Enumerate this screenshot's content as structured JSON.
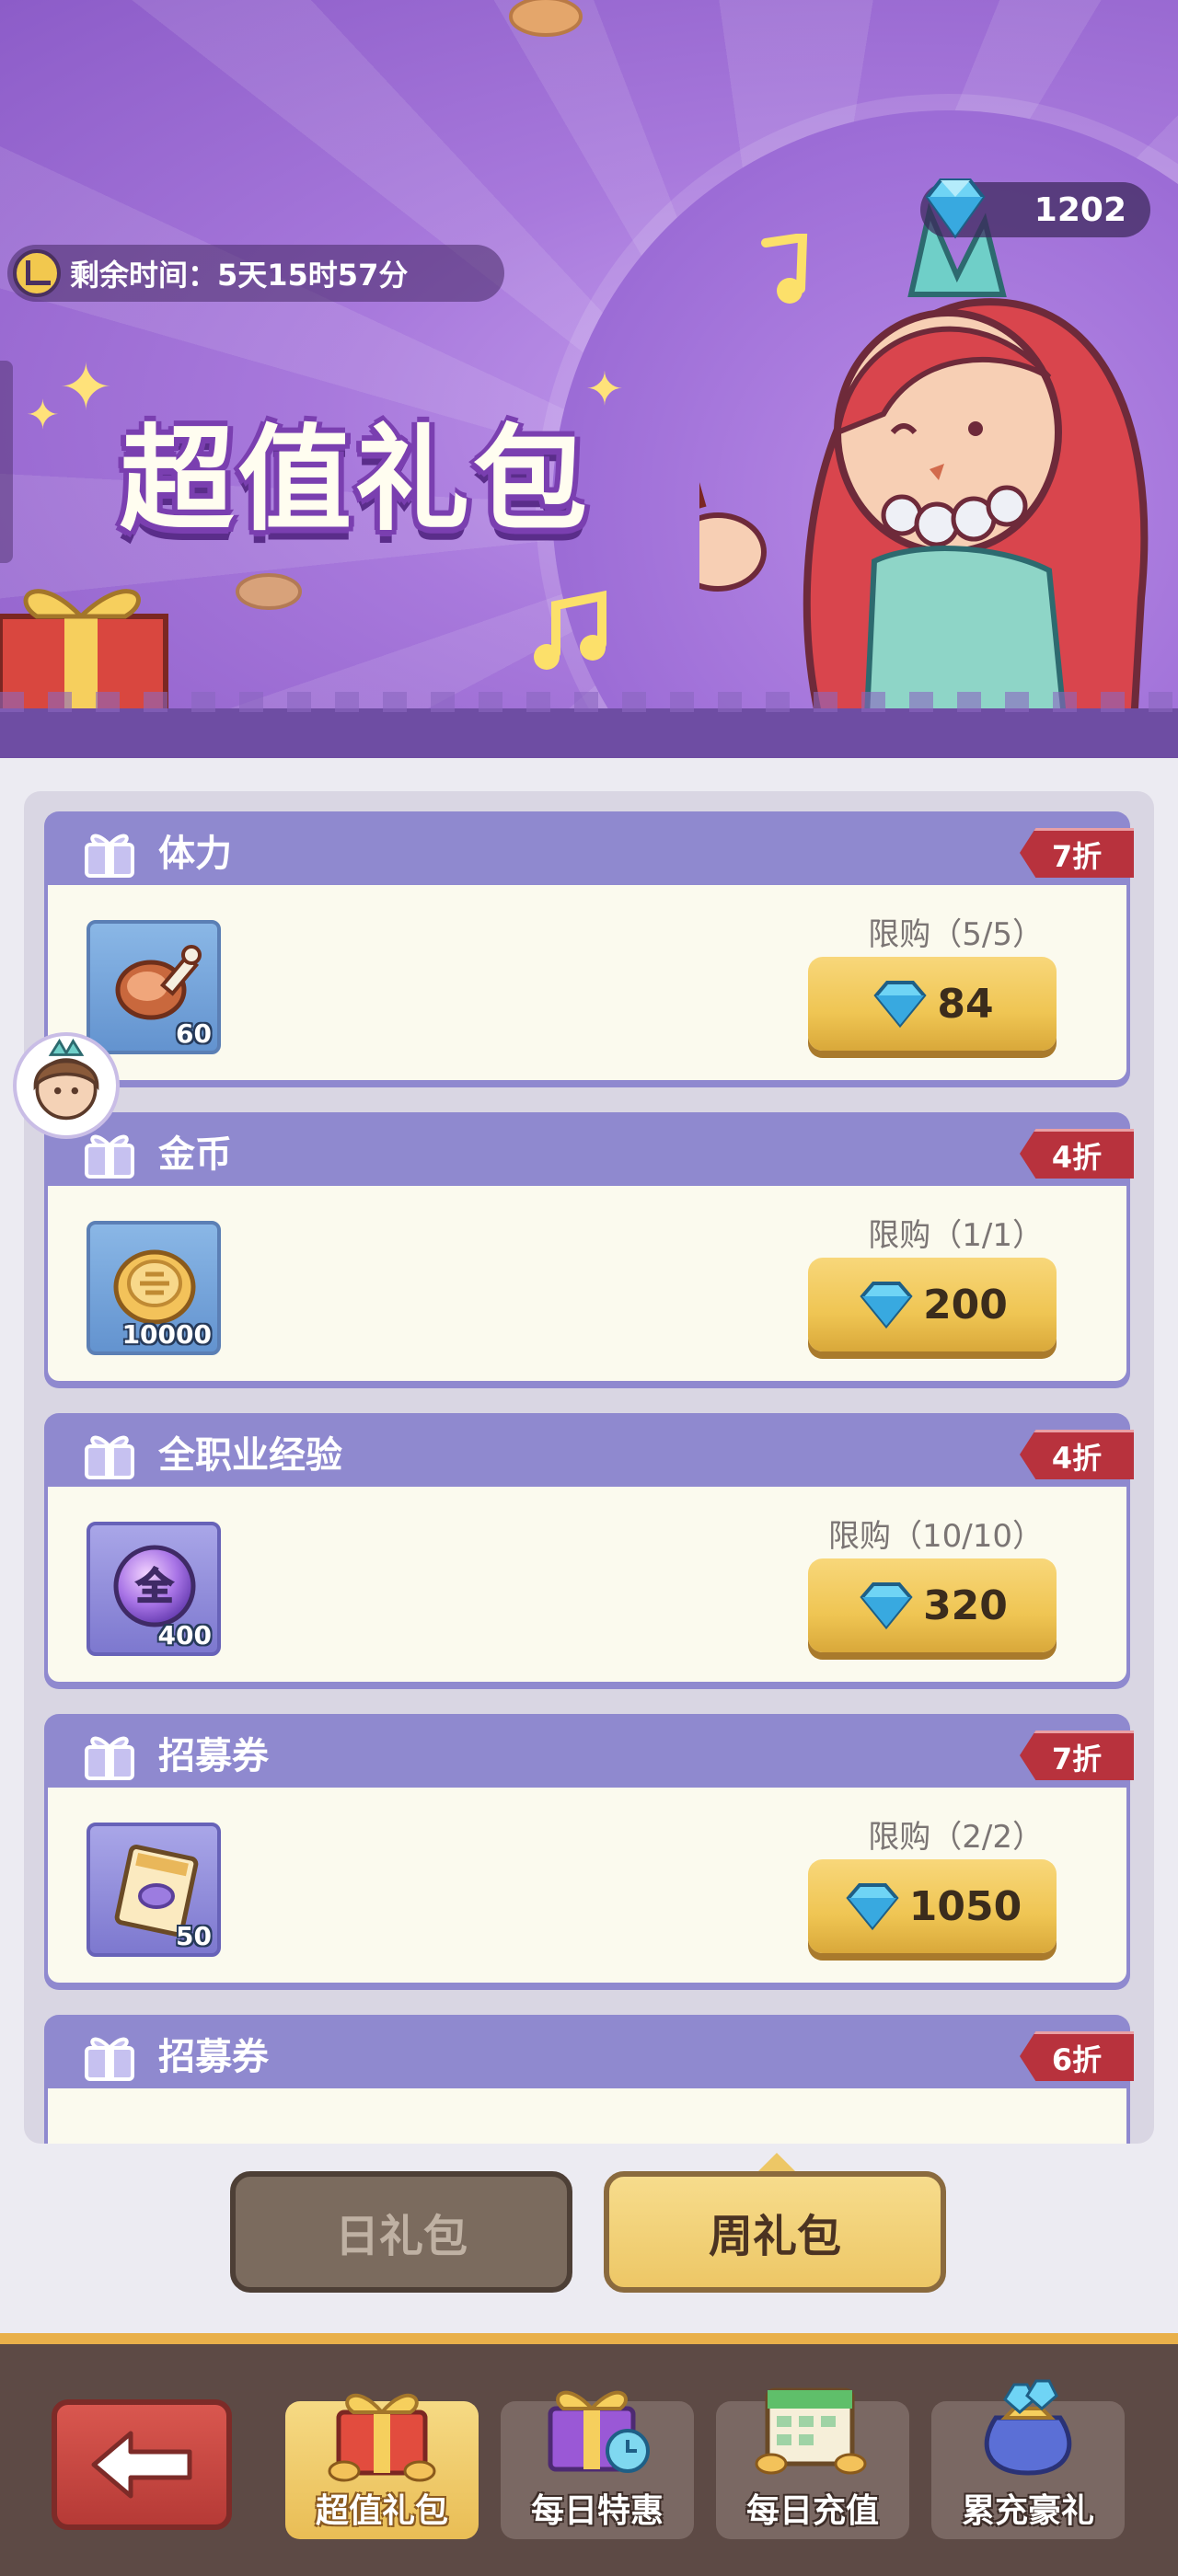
{
  "banner": {
    "gem_count": "1202",
    "timer_text": "剩余时间：5天15时57分",
    "title": "超值礼包"
  },
  "packages": [
    {
      "name": "体力",
      "discount": "7折",
      "limit": "限购（5/5）",
      "price": "84",
      "qty": "60",
      "icon": "meat-icon"
    },
    {
      "name": "金币",
      "discount": "4折",
      "limit": "限购（1/1）",
      "price": "200",
      "qty": "10000",
      "icon": "coin-icon"
    },
    {
      "name": "全职业经验",
      "discount": "4折",
      "limit": "限购（10/10）",
      "price": "320",
      "qty": "400",
      "icon": "exp-orb-icon",
      "orb_label": "全"
    },
    {
      "name": "招募券",
      "discount": "7折",
      "limit": "限购（2/2）",
      "price": "1050",
      "qty": "50",
      "icon": "ticket-icon"
    },
    {
      "name": "招募券",
      "discount": "6折",
      "icon": "ticket-icon"
    }
  ],
  "tabs": {
    "day": "日礼包",
    "week": "周礼包",
    "selected": "week"
  },
  "bottom_nav": {
    "items": [
      {
        "label": "超值礼包",
        "active": true,
        "icon": "gift-box-icon"
      },
      {
        "label": "每日特惠",
        "active": false,
        "icon": "gift-clock-icon"
      },
      {
        "label": "每日充值",
        "active": false,
        "icon": "calendar-coins-icon"
      },
      {
        "label": "累充豪礼",
        "active": false,
        "icon": "gem-bag-icon"
      }
    ]
  },
  "colors": {
    "banner_purple": "#a879dc",
    "card_header": "#8f89cf",
    "discount_red": "#b8323d",
    "button_gold": "#efc553",
    "nav_brown": "#5d4a45"
  }
}
